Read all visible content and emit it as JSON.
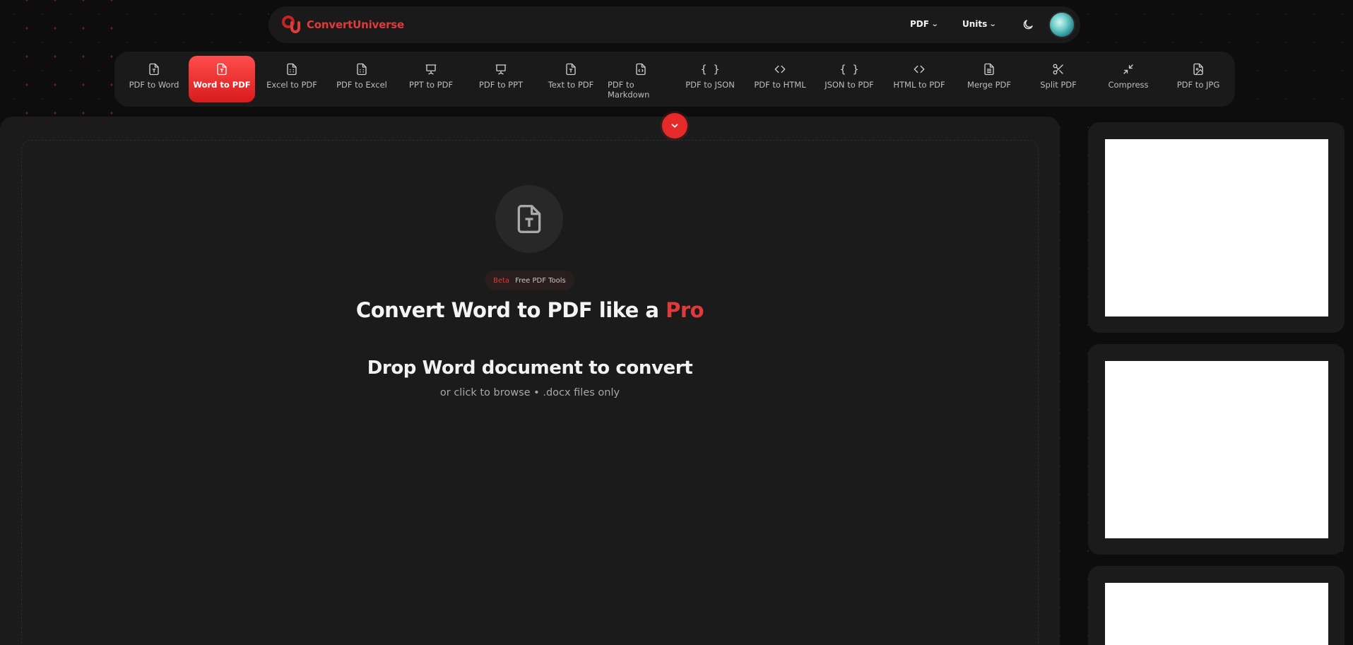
{
  "brand": {
    "name": "ConvertUniverse",
    "accent": "#e23a3a"
  },
  "header": {
    "menus": [
      {
        "label": "PDF"
      },
      {
        "label": "Units"
      }
    ],
    "theme_toggle_icon": "moon-icon",
    "avatar": "avatar"
  },
  "tools": [
    {
      "label": "PDF to Word",
      "icon": "file-text-icon",
      "active": false
    },
    {
      "label": "Word to PDF",
      "icon": "file-text-icon",
      "active": true
    },
    {
      "label": "Excel to PDF",
      "icon": "spreadsheet-icon",
      "active": false
    },
    {
      "label": "PDF to Excel",
      "icon": "spreadsheet-icon",
      "active": false
    },
    {
      "label": "PPT to PDF",
      "icon": "presentation-icon",
      "active": false
    },
    {
      "label": "PDF to PPT",
      "icon": "presentation-icon",
      "active": false
    },
    {
      "label": "Text to PDF",
      "icon": "file-text-icon",
      "active": false
    },
    {
      "label": "PDF to Markdown",
      "icon": "file-code-icon",
      "active": false
    },
    {
      "label": "PDF to JSON",
      "icon": "braces-icon",
      "active": false
    },
    {
      "label": "PDF to HTML",
      "icon": "code-icon",
      "active": false
    },
    {
      "label": "JSON to PDF",
      "icon": "braces-icon",
      "active": false
    },
    {
      "label": "HTML to PDF",
      "icon": "code-icon",
      "active": false
    },
    {
      "label": "Merge PDF",
      "icon": "document-icon",
      "active": false
    },
    {
      "label": "Split PDF",
      "icon": "scissors-icon",
      "active": false
    },
    {
      "label": "Compress",
      "icon": "compress-icon",
      "active": false
    },
    {
      "label": "PDF to JPG",
      "icon": "file-image-icon",
      "active": false
    }
  ],
  "hero": {
    "badge_primary": "Beta",
    "badge_secondary": "Free PDF Tools",
    "headline_main": "Convert Word to PDF like a ",
    "headline_accent": "Pro",
    "drop_title": "Drop Word document to convert",
    "drop_subtitle": "or click to browse • .docx files only"
  },
  "preview": {
    "page_count_visible": 3
  }
}
